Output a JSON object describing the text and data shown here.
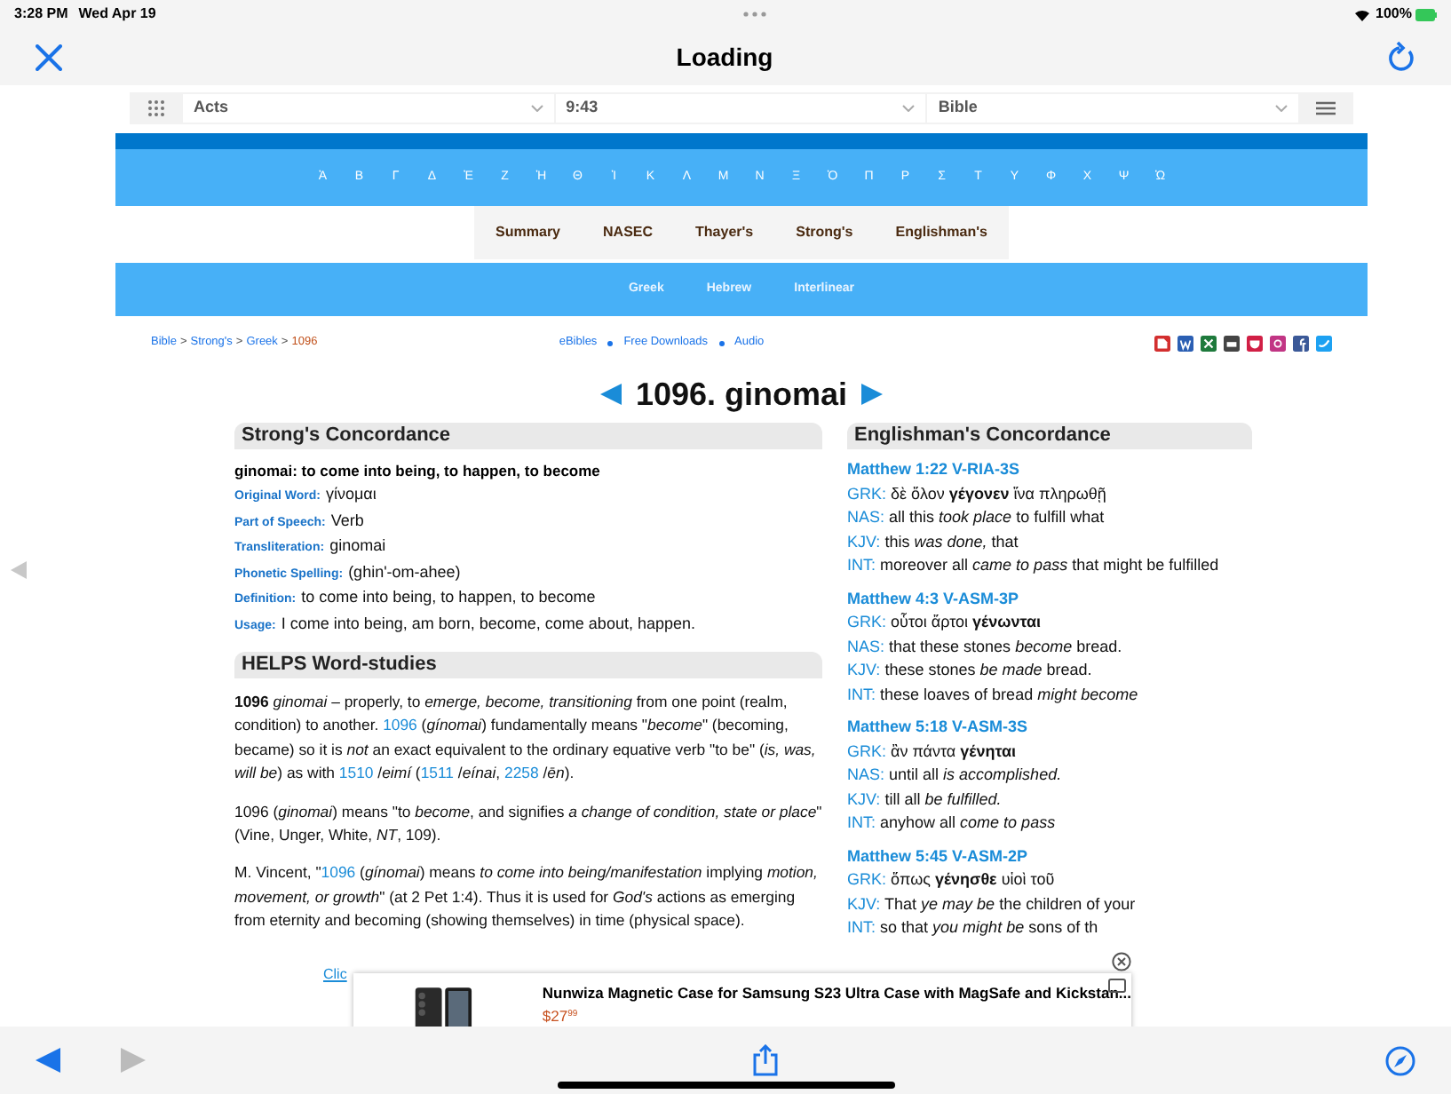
{
  "status_bar": {
    "time": "3:28 PM",
    "date": "Wed Apr 19",
    "battery": "100%"
  },
  "nav_bar": {
    "title": "Loading"
  },
  "selectors": [
    {
      "value": "Acts"
    },
    {
      "value": "9:43"
    },
    {
      "value": "Bible"
    }
  ],
  "alphabet": [
    "Ἀ",
    "Β",
    "Γ",
    "Δ",
    "Ἐ",
    "Ζ",
    "Ἠ",
    "Θ",
    "Ἰ",
    "Κ",
    "Λ",
    "Μ",
    "Ν",
    "Ξ",
    "Ὀ",
    "Π",
    "Ρ",
    "Σ",
    "Τ",
    "Υ",
    "Φ",
    "Χ",
    "Ψ",
    "Ὠ"
  ],
  "tabs": [
    {
      "label": "Summary",
      "selected": false
    },
    {
      "label": "NASEC",
      "selected": false
    },
    {
      "label": "Thayer's",
      "selected": false
    },
    {
      "label": "Strong's",
      "selected": false
    },
    {
      "label": "Englishman's",
      "selected": false
    }
  ],
  "sub_tabs": [
    {
      "label": "Greek",
      "selected": false
    },
    {
      "label": "Hebrew",
      "selected": false
    },
    {
      "label": "Interlinear",
      "selected": false
    }
  ],
  "breadcrumb": {
    "separator": ">",
    "items": [
      {
        "label": "Bible",
        "kind": "link"
      },
      {
        "label": "Strong's",
        "kind": "link"
      },
      {
        "label": "Greek",
        "kind": "link"
      },
      {
        "label": "1096",
        "kind": "current"
      }
    ]
  },
  "site_links": [
    "eBibles",
    "Free Downloads",
    "Audio"
  ],
  "title": "1096. ginomai",
  "strongs": {
    "heading": "Strong's Concordance",
    "headline": "ginomai: to come into being, to happen, to become",
    "fields": [
      {
        "label": "Original Word:",
        "value": "γίνομαι"
      },
      {
        "label": "Part of Speech:",
        "value": "Verb"
      },
      {
        "label": "Transliteration:",
        "value": "ginomai"
      },
      {
        "label": "Phonetic Spelling:",
        "value": "(ghin'-om-ahee)"
      },
      {
        "label": "Definition:",
        "value": "to come into being, to happen, to become"
      },
      {
        "label": "Usage:",
        "value": "I come into being, am born, become, come about, happen."
      }
    ]
  },
  "helps": {
    "heading": "HELPS Word-studies",
    "paragraphs": [
      [
        {
          "kind": "text",
          "text": "**1096** *ginomai* – properly, to *emerge, become, transitioning* from one point (realm, condition) to another. "
        },
        {
          "kind": "link",
          "text": "1096"
        },
        {
          "kind": "text",
          "text": " (*gínomai*) fundamentally means \"*become*\" (becoming, became) so it is *not* an exact equivalent to the ordinary equative verb \"to be\" (*is, was, will be*) as with "
        },
        {
          "kind": "link",
          "text": "1510"
        },
        {
          "kind": "text",
          "text": " /*eimí* ("
        },
        {
          "kind": "link",
          "text": "1511"
        },
        {
          "kind": "text",
          "text": " /*eínai*, "
        },
        {
          "kind": "link",
          "text": "2258"
        },
        {
          "kind": "text",
          "text": " /*ēn*)."
        }
      ],
      [
        {
          "kind": "text",
          "text": "1096 (*ginomai*) means \"to *become*, and signifies *a change of condition, state or place*\" (Vine, Unger, White, *NT*, 109)."
        }
      ],
      [
        {
          "kind": "text",
          "text": "M. Vincent, \""
        },
        {
          "kind": "link",
          "text": "1096"
        },
        {
          "kind": "text",
          "text": " (*gínomai*) means *to come into being/manifestation* implying *motion, movement, or growth*\" (at 2 Pet 1:4). Thus it is used for *God's* actions as emerging from eternity and becoming (showing themselves) in time (physical space)."
        }
      ]
    ],
    "cut_link": "Clic"
  },
  "englishmans": {
    "heading": "Englishman's Concordance",
    "entries": [
      {
        "ref": "Matthew 1:22 V-RIA-3S",
        "lines": [
          {
            "label": "GRK:",
            "text": "δὲ ὅλον **γέγονεν** ἵνα πληρωθῇ"
          },
          {
            "label": "NAS:",
            "text": "all this *took place* to fulfill what"
          },
          {
            "label": "KJV:",
            "text": "this *was done,* that"
          },
          {
            "label": "INT:",
            "text": "moreover all *came to pass* that might be fulfilled"
          }
        ]
      },
      {
        "ref": "Matthew 4:3 V-ASM-3P",
        "lines": [
          {
            "label": "GRK:",
            "text": "οὗτοι ἄρτοι **γένωνται**"
          },
          {
            "label": "NAS:",
            "text": "that these stones *become* bread."
          },
          {
            "label": "KJV:",
            "text": "these stones *be made* bread."
          },
          {
            "label": "INT:",
            "text": "these loaves of bread *might become*"
          }
        ]
      },
      {
        "ref": "Matthew 5:18 V-ASM-3S",
        "lines": [
          {
            "label": "GRK:",
            "text": "ἂν πάντα **γένηται**"
          },
          {
            "label": "NAS:",
            "text": "until all *is accomplished.*"
          },
          {
            "label": "KJV:",
            "text": "till all *be fulfilled.*"
          },
          {
            "label": "INT:",
            "text": "anyhow all *come to pass*"
          }
        ]
      },
      {
        "ref": "Matthew 5:45 V-ASM-2P",
        "lines": [
          {
            "label": "GRK:",
            "text": "ὅπως **γένησθε** υἱοὶ τοῦ"
          },
          {
            "label": "KJV:",
            "text": "That *ye may be* the children of your"
          },
          {
            "label": "INT:",
            "text": "so that *you might be* sons of th"
          }
        ]
      }
    ]
  },
  "ad": {
    "title": "Nunwiza Magnetic Case for Samsung S23 Ultra Case with MagSafe and Kickstan...",
    "price": "$27",
    "cents": "99"
  },
  "toolbar": {
    "back_disabled": false,
    "forward_disabled": true
  }
}
